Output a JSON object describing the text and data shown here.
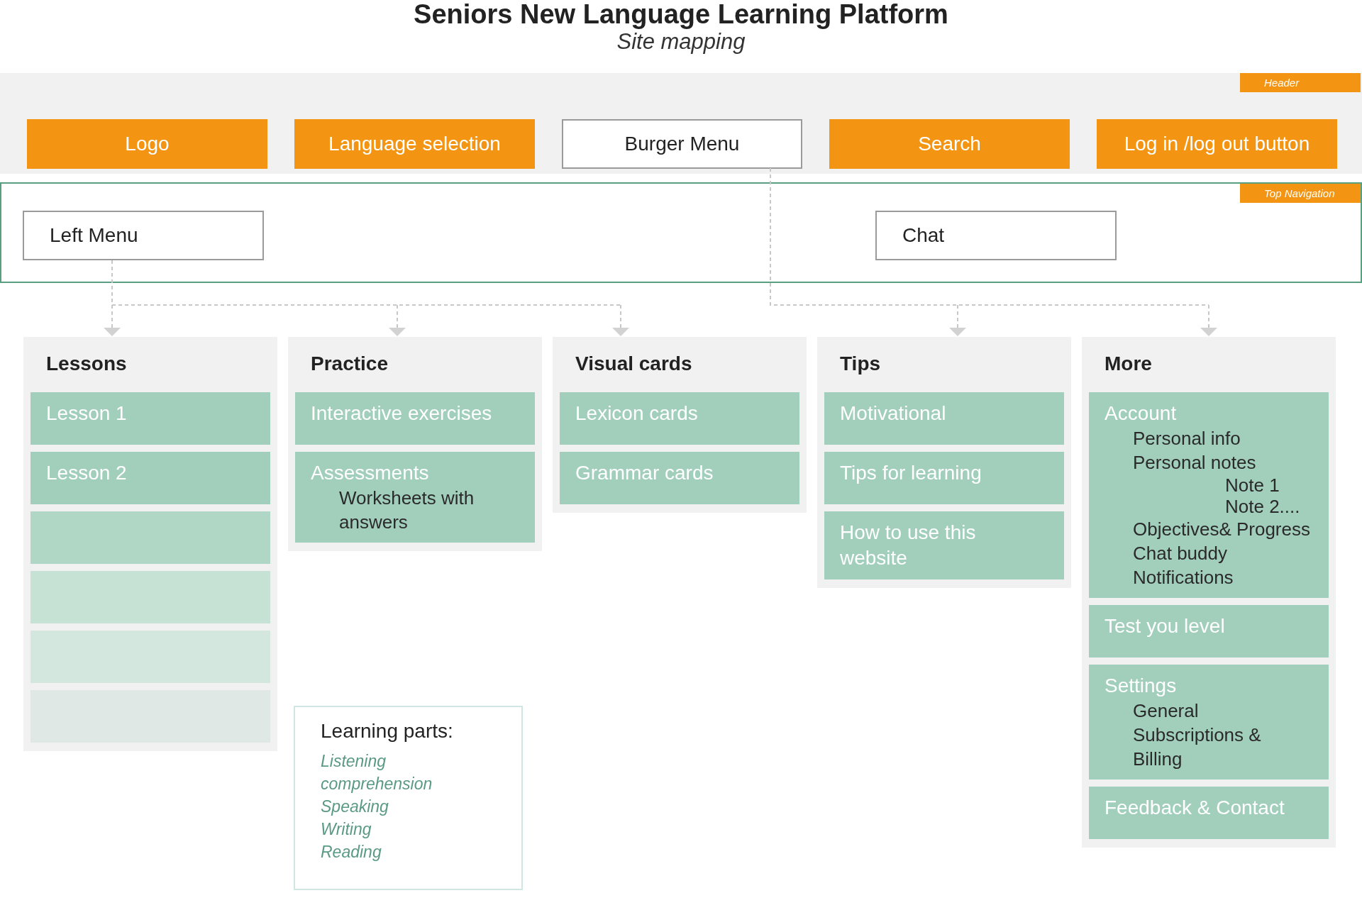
{
  "title": "Seniors New Language Learning Platform",
  "subtitle": "Site mapping",
  "header": {
    "tag": "Header",
    "buttons": [
      {
        "label": "Logo",
        "kind": "filled"
      },
      {
        "label": "Language selection",
        "kind": "filled"
      },
      {
        "label": "Burger Menu",
        "kind": "outline"
      },
      {
        "label": "Search",
        "kind": "filled"
      },
      {
        "label": "Log in /log out button",
        "kind": "filled"
      }
    ]
  },
  "top_navigation": {
    "tag": "Top Navigation",
    "items": [
      {
        "label": "Left Menu"
      },
      {
        "label": "Chat"
      }
    ]
  },
  "columns": [
    {
      "title": "Lessons",
      "items": [
        {
          "kind": "page",
          "label": "Lesson 1"
        },
        {
          "kind": "page",
          "label": "Lesson 2"
        },
        {
          "kind": "empty"
        },
        {
          "kind": "empty"
        },
        {
          "kind": "empty"
        },
        {
          "kind": "empty"
        }
      ]
    },
    {
      "title": "Practice",
      "items": [
        {
          "kind": "page",
          "label": "Interactive exercises"
        },
        {
          "kind": "page",
          "label": "Assessments",
          "children": [
            {
              "label": "Worksheets with answers"
            }
          ]
        }
      ]
    },
    {
      "title": "Visual cards",
      "items": [
        {
          "kind": "page",
          "label": "Lexicon cards"
        },
        {
          "kind": "page",
          "label": "Grammar cards"
        }
      ]
    },
    {
      "title": "Tips",
      "items": [
        {
          "kind": "page",
          "label": "Motivational"
        },
        {
          "kind": "page",
          "label": "Tips for learning"
        },
        {
          "kind": "page",
          "label": "How to use this website"
        }
      ]
    },
    {
      "title": "More",
      "items": [
        {
          "kind": "page",
          "label": "Account",
          "children": [
            {
              "label": "Personal info"
            },
            {
              "label": "Personal notes",
              "children": [
                {
                  "label": "Note 1"
                },
                {
                  "label": "Note 2...."
                }
              ]
            },
            {
              "label": "Objectives& Progress"
            },
            {
              "label": "Chat buddy"
            },
            {
              "label": "Notifications"
            }
          ]
        },
        {
          "kind": "page",
          "label": "Test you level"
        },
        {
          "kind": "page",
          "label": "Settings",
          "children": [
            {
              "label": "General"
            },
            {
              "label": "Subscriptions & Billing"
            }
          ]
        },
        {
          "kind": "page",
          "label": "Feedback & Contact"
        }
      ]
    }
  ],
  "learning_parts": {
    "title": "Learning parts:",
    "items": [
      "Listening comprehension",
      "Speaking",
      "Writing",
      "Reading"
    ]
  }
}
